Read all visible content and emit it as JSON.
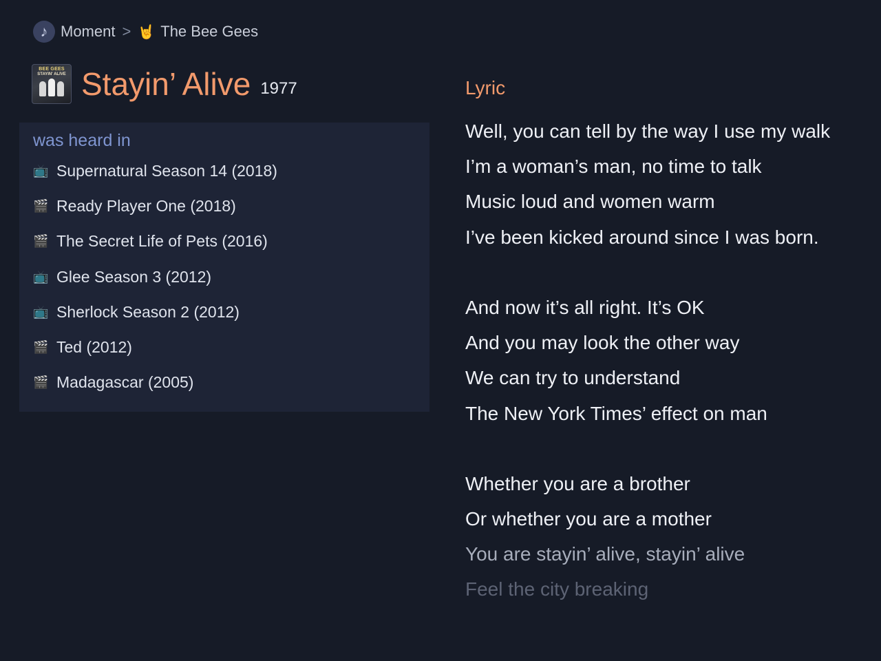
{
  "breadcrumb": {
    "items": [
      {
        "icon": "music-note-icon",
        "glyph": "♪",
        "label": "Moment"
      },
      {
        "icon": "rock-hand-icon",
        "glyph": "🤘",
        "label": "The Bee Gees"
      }
    ],
    "separator": ">"
  },
  "song": {
    "cover_icon": "album-cover",
    "cover_text_band": "BEE GEES",
    "cover_text_title": "STAYIN' ALIVE",
    "title": "Stayin’ Alive",
    "year": "1977"
  },
  "heard_in": {
    "title": "was heard in",
    "items": [
      {
        "type": "tv",
        "icon": "tv-icon",
        "glyph": "📺",
        "label": "Supernatural Season 14 (2018)"
      },
      {
        "type": "movie",
        "icon": "clapperboard-icon",
        "glyph": "🎬",
        "label": "Ready Player One (2018)"
      },
      {
        "type": "movie",
        "icon": "clapperboard-icon",
        "glyph": "🎬",
        "label": "The Secret Life of Pets (2016)"
      },
      {
        "type": "tv",
        "icon": "tv-icon",
        "glyph": "📺",
        "label": "Glee Season 3 (2012)"
      },
      {
        "type": "tv",
        "icon": "tv-icon",
        "glyph": "📺",
        "label": "Sherlock Season 2 (2012)"
      },
      {
        "type": "movie",
        "icon": "clapperboard-icon",
        "glyph": "🎬",
        "label": "Ted (2012)"
      },
      {
        "type": "movie",
        "icon": "clapperboard-icon",
        "glyph": "🎬",
        "label": "Madagascar (2005)"
      }
    ]
  },
  "lyric": {
    "title": "Lyric",
    "lines": [
      "Well, you can tell by the way I use my walk",
      "I’m a woman’s man, no time to talk",
      "Music loud and women warm",
      "I’ve been kicked around since I was born.",
      "",
      "And now it’s all right. It’s OK",
      "And you may look the other way",
      "We can try to understand",
      "The New York Times’ effect on man",
      "",
      "Whether you are a brother",
      "Or whether you are a mother",
      "You are stayin’ alive, stayin’ alive",
      "Feel the city breaking"
    ]
  },
  "colors": {
    "background": "#161b27",
    "panel": "#1e2436",
    "accent": "#f29a6c",
    "panel_title": "#7f95d0"
  }
}
